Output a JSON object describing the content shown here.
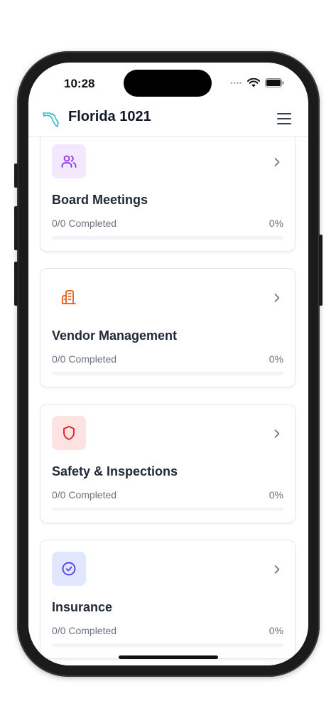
{
  "status_bar": {
    "time": "10:28"
  },
  "header": {
    "title": "Florida 1021",
    "logo_icon": "florida-outline-icon",
    "menu_icon": "hamburger-menu-icon"
  },
  "colors": {
    "purple": "#9333ea",
    "purple_bg": "#f3e8ff",
    "orange": "#ea580c",
    "orange_bg": "#ffffff",
    "red": "#dc2626",
    "red_bg": "#fee2e2",
    "indigo": "#4f46e5",
    "indigo_bg": "#e0e7ff"
  },
  "categories": [
    {
      "title": "Board Meetings",
      "progress_text": "0/0 Completed",
      "percent_label": "0%",
      "progress": 0,
      "icon": "users-icon"
    },
    {
      "title": "Vendor Management",
      "progress_text": "0/0 Completed",
      "percent_label": "0%",
      "progress": 0,
      "icon": "building-icon"
    },
    {
      "title": "Safety & Inspections",
      "progress_text": "0/0 Completed",
      "percent_label": "0%",
      "progress": 0,
      "icon": "shield-icon"
    },
    {
      "title": "Insurance",
      "progress_text": "0/0 Completed",
      "percent_label": "0%",
      "progress": 0,
      "icon": "check-circle-icon"
    }
  ]
}
